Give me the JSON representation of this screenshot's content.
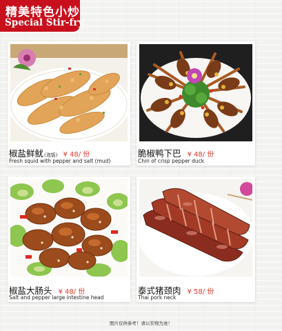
{
  "header": {
    "title_cn": "精美特色小炒",
    "title_en": "Special Stir-fry"
  },
  "dishes": [
    {
      "name_cn": "椒盐鲜鱿",
      "note": "(泡饭)",
      "price": "¥ 48/ 份",
      "name_en": "Fresh squid with pepper and salt (mud)",
      "image_icon": "fried-squid-photo"
    },
    {
      "name_cn": "脆椒鸭下巴",
      "note": "",
      "price": "¥ 48/ 份",
      "name_en": "Chin of crisp pepper duck",
      "image_icon": "duck-chin-photo"
    },
    {
      "name_cn": "椒盐大肠头",
      "note": "",
      "price": "¥ 48/ 份",
      "name_en": "Salt and pepper large intestine head",
      "image_icon": "pork-intestine-photo"
    },
    {
      "name_cn": "泰式猪颈肉",
      "note": "",
      "price": "¥ 58/ 份",
      "name_en": "Thai pork neck",
      "image_icon": "pork-neck-photo"
    }
  ],
  "footer": {
    "disclaimer": "图片仅供参考！请以实物为准！"
  },
  "colors": {
    "brand_red": "#c8101d",
    "price_red": "#e33a2a",
    "background": "#f2f2f0"
  }
}
